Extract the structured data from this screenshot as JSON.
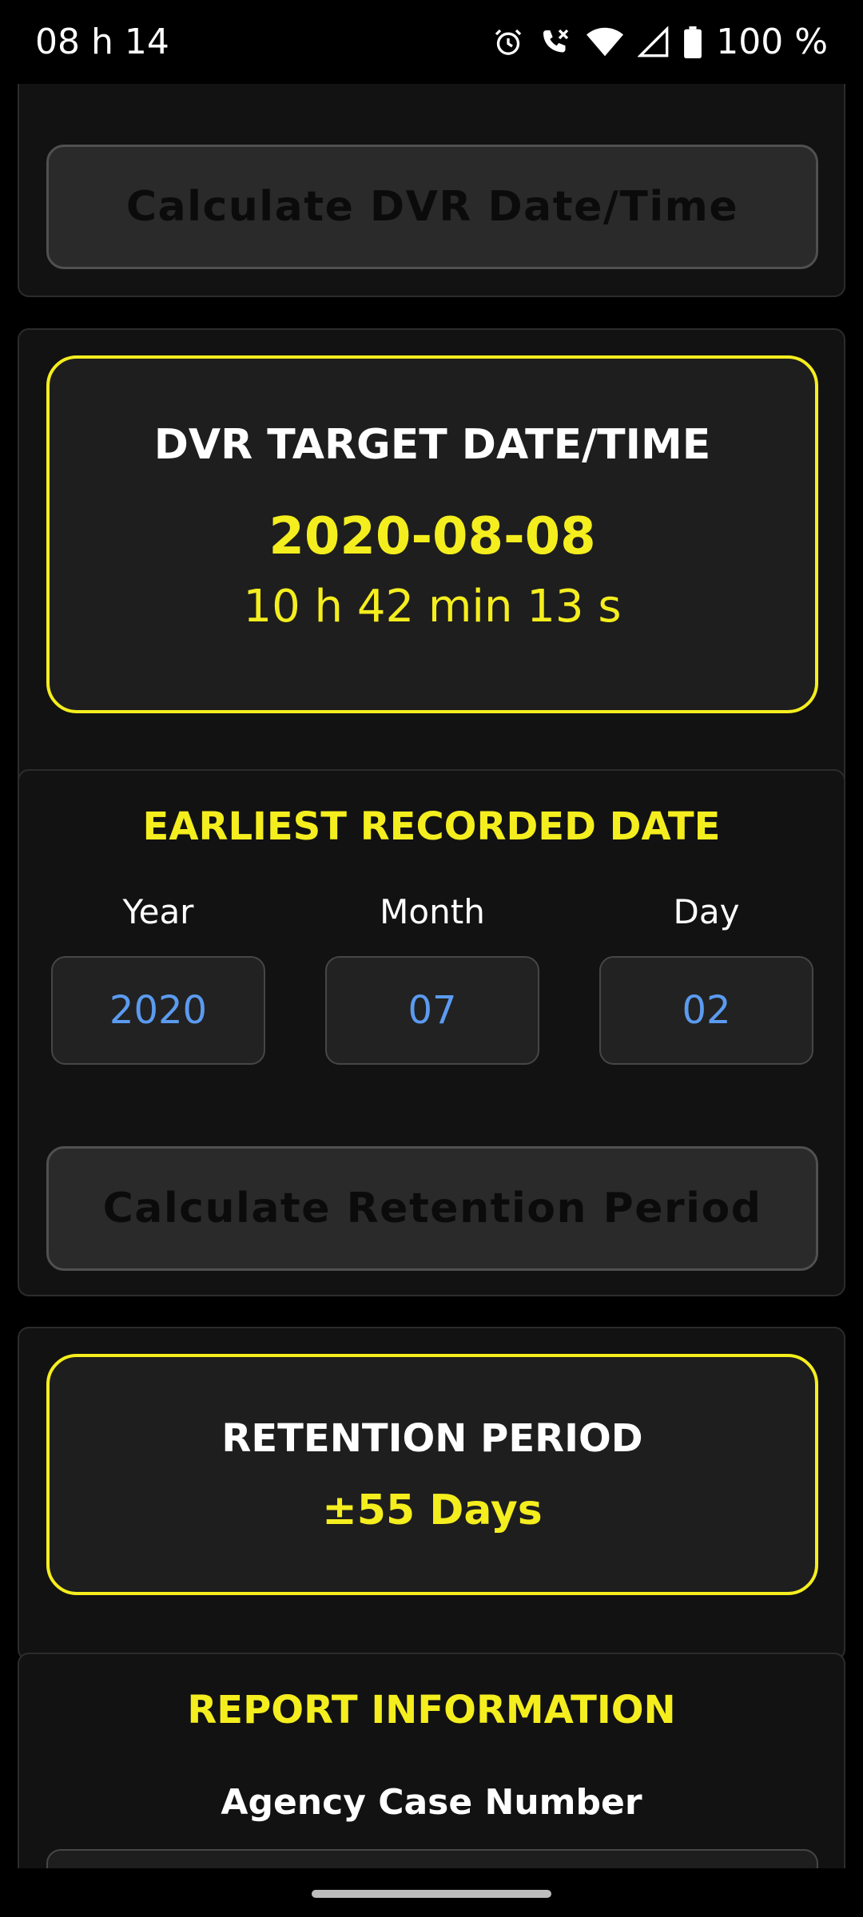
{
  "status_bar": {
    "time": "08 h 14",
    "battery": "100 %",
    "icons": [
      "alarm-icon",
      "wifi-calling-icon",
      "wifi-icon",
      "signal-icon",
      "battery-icon"
    ]
  },
  "calc_dvr_button": {
    "label": "Calculate DVR Date/Time"
  },
  "dvr_target": {
    "title": "DVR TARGET DATE/TIME",
    "date": "2020-08-08",
    "time": "10 h 42 min 13 s"
  },
  "earliest_recorded": {
    "title": "EARLIEST RECORDED DATE",
    "fields": [
      {
        "label": "Year",
        "value": "2020"
      },
      {
        "label": "Month",
        "value": "07"
      },
      {
        "label": "Day",
        "value": "02"
      }
    ],
    "button_label": "Calculate Retention Period"
  },
  "retention": {
    "title": "RETENTION PERIOD",
    "value": "±55 Days"
  },
  "report": {
    "title": "REPORT INFORMATION",
    "case_number_label": "Agency Case Number",
    "case_number_value": ""
  },
  "colors": {
    "accent": "#f5ee1e",
    "value_blue": "#5b9bf0",
    "card": "#121212"
  }
}
